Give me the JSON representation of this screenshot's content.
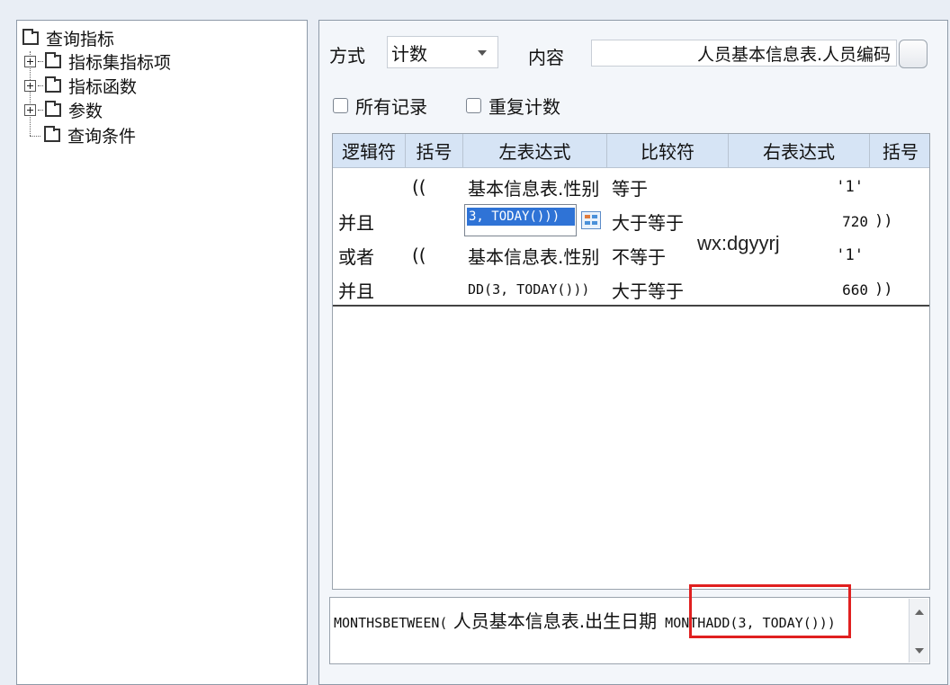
{
  "tree": {
    "root": "查询指标",
    "items": [
      {
        "label": "指标集指标项",
        "expandable": true
      },
      {
        "label": "指标函数",
        "expandable": true
      },
      {
        "label": "参数",
        "expandable": true
      },
      {
        "label": "查询条件",
        "expandable": false
      }
    ]
  },
  "form": {
    "mode_label": "方式",
    "mode_value": "计数",
    "content_label": "内容",
    "content_value": "人员基本信息表.人员编码",
    "all_records_label": "所有记录",
    "repeat_count_label": "重复计数"
  },
  "grid": {
    "columns": [
      "逻辑符",
      "括号",
      "左表达式",
      "比较符",
      "右表达式",
      "括号"
    ],
    "rows": [
      {
        "logic": "",
        "lparen": "((",
        "left": "基本信息表.性别",
        "op": "等于",
        "right": "'1'",
        "rparen": ""
      },
      {
        "logic": "并且",
        "lparen": "",
        "left": "",
        "op": "大于等于",
        "right": "720",
        "rparen": "))"
      },
      {
        "logic": "或者",
        "lparen": "((",
        "left": "基本信息表.性别",
        "op": "不等于",
        "right": "'1'",
        "rparen": ""
      },
      {
        "logic": "并且",
        "lparen": "",
        "left": "DD(3, TODAY()))",
        "op": "大于等于",
        "right": "660",
        "rparen": "))"
      }
    ],
    "editing_text": "3, TODAY()))"
  },
  "watermark": "wx:dgyyrj",
  "expression": {
    "part1": "MONTHSBETWEEN(",
    "part2": " 人员基本信息表.出生日期",
    "part3": " MONTHADD(3, TODAY()))"
  },
  "colors": {
    "header_bg": "#d6e4f5",
    "selection": "#2f73d6",
    "highlight_box": "#e02020"
  }
}
